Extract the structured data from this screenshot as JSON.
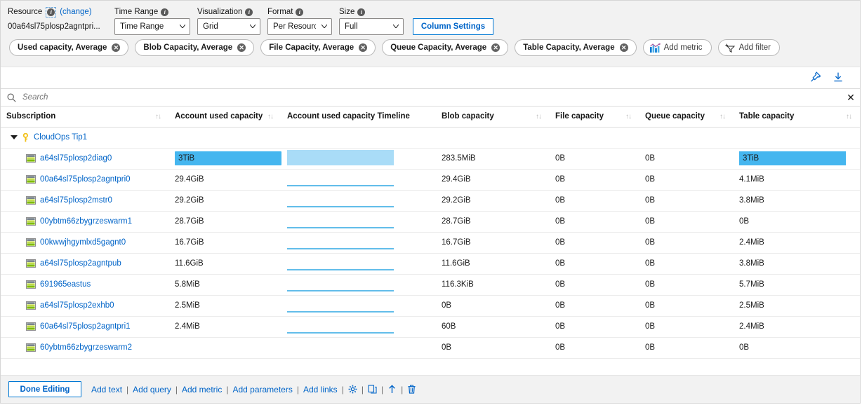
{
  "params": {
    "resource": {
      "label": "Resource",
      "change_link": "(change)",
      "value": "00a64sl75plosp2agntpri...",
      "info_icon": "info-icon"
    },
    "time_range": {
      "label": "Time Range",
      "value": "Time Range",
      "info_icon": "info-icon"
    },
    "visualization": {
      "label": "Visualization",
      "value": "Grid",
      "info_icon": "info-icon"
    },
    "format": {
      "label": "Format",
      "value": "Per Resource",
      "info_icon": "info-icon"
    },
    "size": {
      "label": "Size",
      "value": "Full",
      "info_icon": "info-icon"
    },
    "column_settings_label": "Column Settings"
  },
  "pills": [
    {
      "label": "Used capacity, Average",
      "removable": true
    },
    {
      "label": "Blob Capacity, Average",
      "removable": true
    },
    {
      "label": "File Capacity, Average",
      "removable": true
    },
    {
      "label": "Queue Capacity, Average",
      "removable": true
    },
    {
      "label": "Table Capacity, Average",
      "removable": true
    },
    {
      "label": "Add metric",
      "removable": false,
      "icon": "chart-bar-icon"
    },
    {
      "label": "Add filter",
      "removable": false,
      "icon": "filter-plus-icon"
    }
  ],
  "toolbar": {
    "pin_icon": "pin-icon",
    "download_icon": "download-icon"
  },
  "search": {
    "placeholder": "Search",
    "value": "",
    "icon": "search-icon",
    "clear_icon": "close-icon"
  },
  "table": {
    "columns": [
      {
        "label": "Subscription",
        "sortable": true
      },
      {
        "label": "Account used capacity",
        "sortable": true
      },
      {
        "label": "Account used capacity Timeline",
        "sortable": false
      },
      {
        "label": "Blob capacity",
        "sortable": true
      },
      {
        "label": "File capacity",
        "sortable": true
      },
      {
        "label": "Queue capacity",
        "sortable": true
      },
      {
        "label": "Table capacity",
        "sortable": true
      }
    ],
    "group": {
      "label": "CloudOps Tip1",
      "icon": "key-icon",
      "expanded": true
    },
    "rows": [
      {
        "name": "a64sl75plosp2diag0",
        "used": "3TiB",
        "used_bar_pct": 100,
        "timeline": "bar",
        "blob": "283.5MiB",
        "file": "0B",
        "queue": "0B",
        "table": "3TiB",
        "table_highlight": true
      },
      {
        "name": "00a64sl75plosp2agntpri0",
        "used": "29.4GiB",
        "used_bar_pct": 0,
        "timeline": "line",
        "blob": "29.4GiB",
        "file": "0B",
        "queue": "0B",
        "table": "4.1MiB",
        "table_highlight": false
      },
      {
        "name": "a64sl75plosp2mstr0",
        "used": "29.2GiB",
        "used_bar_pct": 0,
        "timeline": "line",
        "blob": "29.2GiB",
        "file": "0B",
        "queue": "0B",
        "table": "3.8MiB",
        "table_highlight": false
      },
      {
        "name": "00ybtm66zbygrzeswarm1",
        "used": "28.7GiB",
        "used_bar_pct": 0,
        "timeline": "line",
        "blob": "28.7GiB",
        "file": "0B",
        "queue": "0B",
        "table": "0B",
        "table_highlight": false
      },
      {
        "name": "00kwwjhgymlxd5gagnt0",
        "used": "16.7GiB",
        "used_bar_pct": 0,
        "timeline": "line",
        "blob": "16.7GiB",
        "file": "0B",
        "queue": "0B",
        "table": "2.4MiB",
        "table_highlight": false
      },
      {
        "name": "a64sl75plosp2agntpub",
        "used": "11.6GiB",
        "used_bar_pct": 0,
        "timeline": "line",
        "blob": "11.6GiB",
        "file": "0B",
        "queue": "0B",
        "table": "3.8MiB",
        "table_highlight": false
      },
      {
        "name": "691965eastus",
        "used": "5.8MiB",
        "used_bar_pct": 0,
        "timeline": "line",
        "blob": "116.3KiB",
        "file": "0B",
        "queue": "0B",
        "table": "5.7MiB",
        "table_highlight": false
      },
      {
        "name": "a64sl75plosp2exhb0",
        "used": "2.5MiB",
        "used_bar_pct": 0,
        "timeline": "line",
        "blob": "0B",
        "file": "0B",
        "queue": "0B",
        "table": "2.5MiB",
        "table_highlight": false
      },
      {
        "name": "60a64sl75plosp2agntpri1",
        "used": "2.4MiB",
        "used_bar_pct": 0,
        "timeline": "line",
        "blob": "60B",
        "file": "0B",
        "queue": "0B",
        "table": "2.4MiB",
        "table_highlight": false
      },
      {
        "name": "60ybtm66zbygrzeswarm2",
        "used": "",
        "used_bar_pct": 0,
        "timeline": "none",
        "blob": "0B",
        "file": "0B",
        "queue": "0B",
        "table": "0B",
        "table_highlight": false
      }
    ]
  },
  "bottom": {
    "done_editing": "Done Editing",
    "links": [
      "Add text",
      "Add query",
      "Add metric",
      "Add parameters",
      "Add links"
    ],
    "separator": "|",
    "icons": [
      "gear-icon",
      "copy-icon",
      "move-up-icon",
      "trash-icon"
    ]
  },
  "colors": {
    "accent_blue": "#0064c8",
    "highlight_bar": "#45b6ef",
    "timeline_fill": "#a9dcf7",
    "timeline_line": "#62bdea",
    "param_bg": "#f2f2f2"
  }
}
